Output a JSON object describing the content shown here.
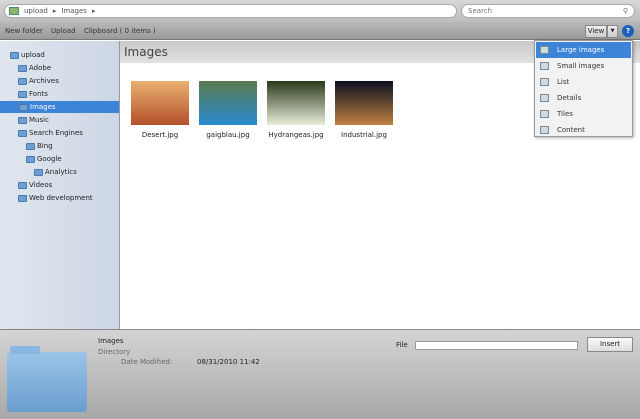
{
  "address": {
    "crumbs": [
      "upload",
      "Images"
    ]
  },
  "search": {
    "placeholder": "Search"
  },
  "toolbar": {
    "new_folder": "New folder",
    "upload": "Upload",
    "clipboard": "Clipboard ( 0 items )",
    "view": "View",
    "help": "?"
  },
  "tree": [
    {
      "label": "upload",
      "level": 0
    },
    {
      "label": "Adobe",
      "level": 1
    },
    {
      "label": "Archives",
      "level": 1
    },
    {
      "label": "Fonts",
      "level": 1
    },
    {
      "label": "Images",
      "level": 1,
      "selected": true
    },
    {
      "label": "Music",
      "level": 1
    },
    {
      "label": "Search Engines",
      "level": 1
    },
    {
      "label": "Bing",
      "level": 2
    },
    {
      "label": "Google",
      "level": 2
    },
    {
      "label": "Analytics",
      "level": 3
    },
    {
      "label": "Videos",
      "level": 1
    },
    {
      "label": "Web development",
      "level": 1
    }
  ],
  "main": {
    "title": "Images",
    "files": [
      {
        "name": "Desert.jpg",
        "colors": [
          "#e8b070",
          "#b4502a"
        ]
      },
      {
        "name": "gaigblau.jpg",
        "colors": [
          "#5a7a50",
          "#2a8ad0"
        ]
      },
      {
        "name": "Hydrangeas.jpg",
        "colors": [
          "#2a3a1a",
          "#e8ecd8"
        ]
      },
      {
        "name": "Industrial.jpg",
        "colors": [
          "#0a1020",
          "#c08040"
        ]
      }
    ]
  },
  "view_menu": {
    "items": [
      "Large images",
      "Small images",
      "List",
      "Details",
      "Tiles",
      "Content"
    ],
    "selected": 0
  },
  "details": {
    "name": "Images",
    "type": "Directory",
    "modified_label": "Date Modified:",
    "modified_value": "08/31/2010 11:42",
    "file_label": "File",
    "insert": "Insert"
  }
}
